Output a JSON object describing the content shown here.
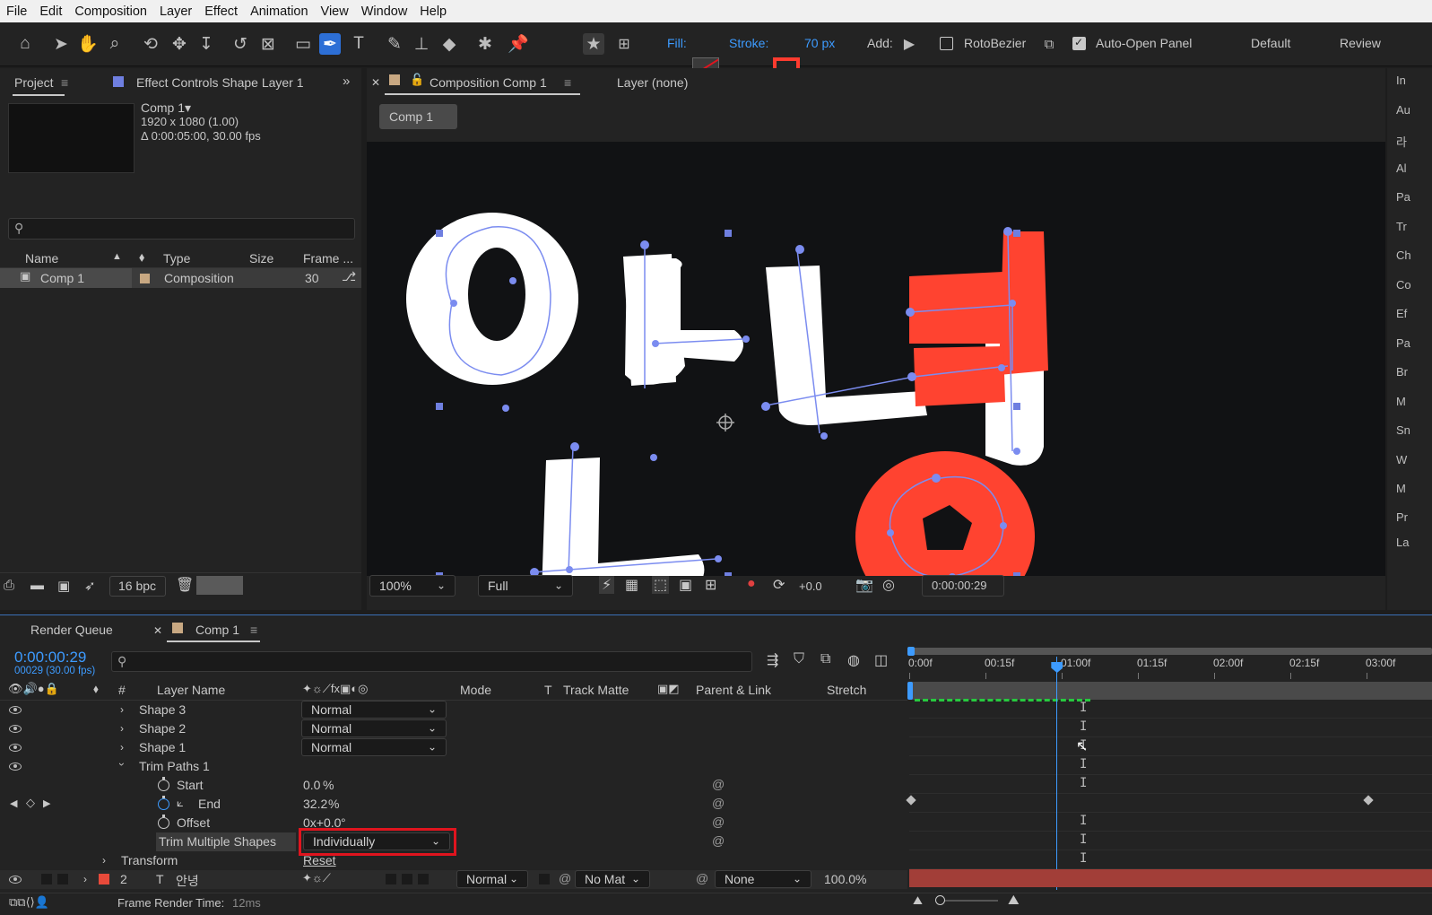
{
  "menu": [
    "File",
    "Edit",
    "Composition",
    "Layer",
    "Effect",
    "Animation",
    "View",
    "Window",
    "Help"
  ],
  "toolbar": {
    "fill_label": "Fill:",
    "stroke_label": "Stroke:",
    "stroke_px": "70 px",
    "add_label": "Add:",
    "rotobezier_label": "RotoBezier",
    "auto_open_label": "Auto-Open Panel",
    "workspace_default": "Default",
    "workspace_review": "Review",
    "icons": [
      "home-icon",
      "selection-tool-icon",
      "hand-tool-icon",
      "zoom-tool-icon",
      "orbit-camera-icon",
      "pan-camera-icon",
      "dolly-camera-icon",
      "rotate-tool-icon",
      "pan-behind-icon",
      "rectangle-tool-icon",
      "pen-tool-icon",
      "type-tool-icon",
      "brush-tool-icon",
      "clone-stamp-icon",
      "eraser-icon",
      "roto-brush-icon",
      "puppet-pin-icon"
    ],
    "stroke_color": "#ff3b2f",
    "accent": "#3d9bff"
  },
  "project": {
    "tab_project": "Project",
    "tab_effect_controls": "Effect Controls Shape Layer 1",
    "comp_name": "Comp 1▾",
    "comp_size": "1920 x 1080 (1.00)",
    "comp_duration": "Δ 0:00:05:00, 30.00 fps",
    "search_icon": "search-icon",
    "columns": {
      "name": "Name",
      "type": "Type",
      "size": "Size",
      "frame": "Frame ..."
    },
    "rows": [
      {
        "name": "Comp 1",
        "type": "Composition",
        "size": "",
        "frame": "30"
      }
    ],
    "bpc": "16 bpc"
  },
  "composition": {
    "tab_comp": "Composition Comp 1",
    "tab_layer": "Layer (none)",
    "breadcrumb": "Comp 1",
    "zoom": "100%",
    "resolution": "Full",
    "exposure": "+0.0",
    "timecode": "0:00:00:29",
    "glyphs": {
      "a": "아",
      "n": "ㄴ",
      "nyeo": "녀",
      "o": "ㅇ"
    },
    "white": "#ffffff",
    "red": "#ff4330",
    "path_color": "#7b8cf0"
  },
  "timeline": {
    "tab_render": "Render Queue",
    "tab_comp": "Comp 1",
    "timecode": "0:00:00:29",
    "frames_fps": "00029 (30.00 fps)",
    "columns": {
      "hash": "#",
      "layer_name": "Layer Name",
      "mode": "Mode",
      "t": "T",
      "track_matte": "Track Matte",
      "parent_link": "Parent & Link",
      "stretch": "Stretch"
    },
    "ruler": [
      "0:00f",
      "00:15f",
      "01:00f",
      "01:15f",
      "02:00f",
      "02:15f",
      "03:00f"
    ],
    "current_time_fraction": 0.29,
    "layers": [
      {
        "name": "Shape 3",
        "mode": "Normal"
      },
      {
        "name": "Shape 2",
        "mode": "Normal"
      },
      {
        "name": "Shape 1",
        "mode": "Normal"
      }
    ],
    "trim_paths": {
      "name": "Trim Paths 1",
      "start_label": "Start",
      "start_value": "0.0",
      "start_unit": "%",
      "end_label": "End",
      "end_value": "32.2",
      "end_unit": "%",
      "offset_label": "Offset",
      "offset_value": "0x+0.0",
      "offset_unit": "°",
      "trim_multiple_label": "Trim Multiple Shapes",
      "trim_multiple_value": "Individually"
    },
    "transform_label": "Transform",
    "reset_label": "Reset",
    "layer2": {
      "index": "2",
      "type_glyph": "T",
      "name": "안녕",
      "mode": "Normal",
      "matte": "No Mat",
      "parent": "None",
      "stretch": "100.0%"
    },
    "footer": "Frame Render Time:",
    "footer_value": "12ms",
    "highlight_color": "#e0141e",
    "layer_color": "#e84a3a"
  },
  "right_panel_tabs": [
    "In",
    "Au",
    "라",
    "Al",
    "Pa",
    "Tr",
    "Ch",
    "Co",
    "Ef",
    "Pa",
    "Br",
    "M",
    "Sn",
    "W",
    "M",
    "Pr",
    "La"
  ]
}
